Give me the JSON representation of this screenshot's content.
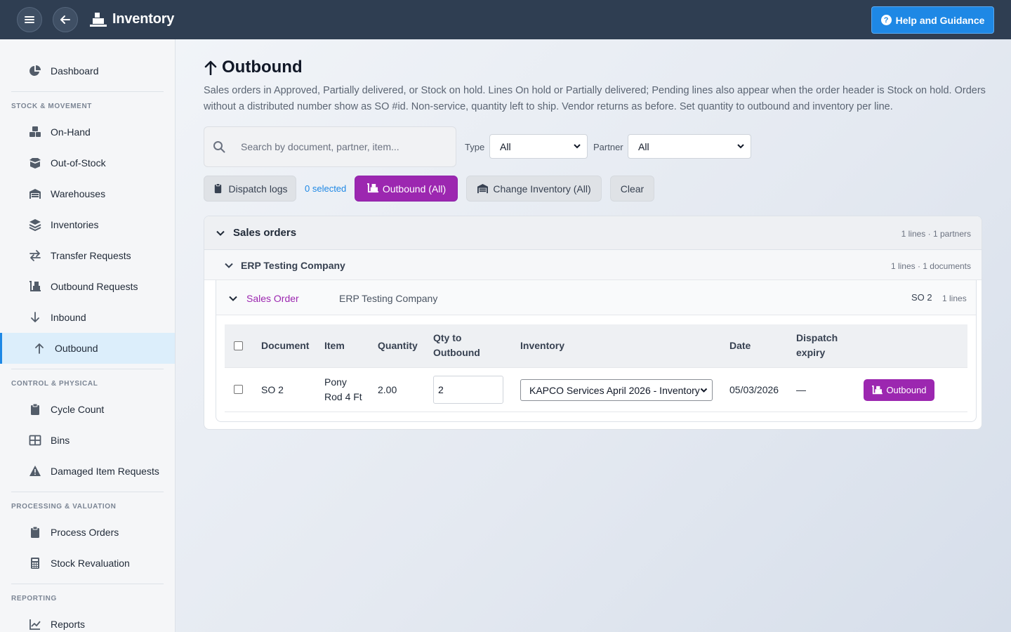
{
  "app": {
    "title": "Inventory",
    "help_label": "Help and Guidance"
  },
  "sidebar": {
    "top": [
      {
        "label": "Dashboard",
        "icon": "pie-chart-icon"
      }
    ],
    "sections": [
      {
        "label": "STOCK & MOVEMENT",
        "items": [
          {
            "label": "On-Hand",
            "icon": "boxes-icon"
          },
          {
            "label": "Out-of-Stock",
            "icon": "open-box-icon"
          },
          {
            "label": "Warehouses",
            "icon": "warehouse-icon"
          },
          {
            "label": "Inventories",
            "icon": "layers-icon"
          },
          {
            "label": "Transfer Requests",
            "icon": "transfer-arrows-icon"
          },
          {
            "label": "Outbound Requests",
            "icon": "dolly-icon"
          },
          {
            "label": "Inbound",
            "icon": "arrow-down-icon"
          },
          {
            "label": "Outbound",
            "icon": "arrow-up-icon",
            "active": true
          }
        ]
      },
      {
        "label": "CONTROL & PHYSICAL",
        "items": [
          {
            "label": "Cycle Count",
            "icon": "clipboard-icon"
          },
          {
            "label": "Bins",
            "icon": "grid-icon"
          },
          {
            "label": "Damaged Item Requests",
            "icon": "warning-icon"
          }
        ]
      },
      {
        "label": "PROCESSING & VALUATION",
        "items": [
          {
            "label": "Process Orders",
            "icon": "clipboard-icon"
          },
          {
            "label": "Stock Revaluation",
            "icon": "calculator-icon"
          }
        ]
      },
      {
        "label": "REPORTING",
        "items": [
          {
            "label": "Reports",
            "icon": "line-chart-icon"
          }
        ]
      }
    ]
  },
  "page": {
    "title": "Outbound",
    "description": "Sales orders in Approved, Partially delivered, or Stock on hold. Lines On hold or Partially delivered; Pending lines also appear when the order header is Stock on hold. Orders without a distributed number show as SO #id. Non-service, quantity left to ship. Vendor returns as before. Set quantity to outbound and inventory per line."
  },
  "filters": {
    "search_placeholder": "Search by document, partner, item...",
    "type_label": "Type",
    "type_value": "All",
    "partner_label": "Partner",
    "partner_value": "All"
  },
  "actions": {
    "dispatch_logs": "Dispatch logs",
    "selected": "0 selected",
    "outbound_all": "Outbound (All)",
    "change_inventory_all": "Change Inventory (All)",
    "clear": "Clear"
  },
  "group": {
    "title": "Sales orders",
    "meta": "1 lines · 1 partners",
    "partner": {
      "name": "ERP Testing Company",
      "meta": "1 lines · 1 documents",
      "document": {
        "type": "Sales Order",
        "partner": "ERP Testing Company",
        "number": "SO  2",
        "lines": "1 lines",
        "columns": [
          "Document",
          "Item",
          "Quantity",
          "Qty to",
          "Outbound",
          "Inventory",
          "Date",
          "Dispatch",
          "expiry"
        ],
        "rows": [
          {
            "document": "SO 2",
            "item_line1": "Pony",
            "item_line2": "Rod 4 Ft",
            "quantity": "2.00",
            "qty_to_outbound": "2",
            "inventory": "KAPCO Services April 2026 - Inventory",
            "date": "05/03/2026",
            "dispatch_expiry": "—",
            "action": "Outbound"
          }
        ]
      }
    }
  }
}
